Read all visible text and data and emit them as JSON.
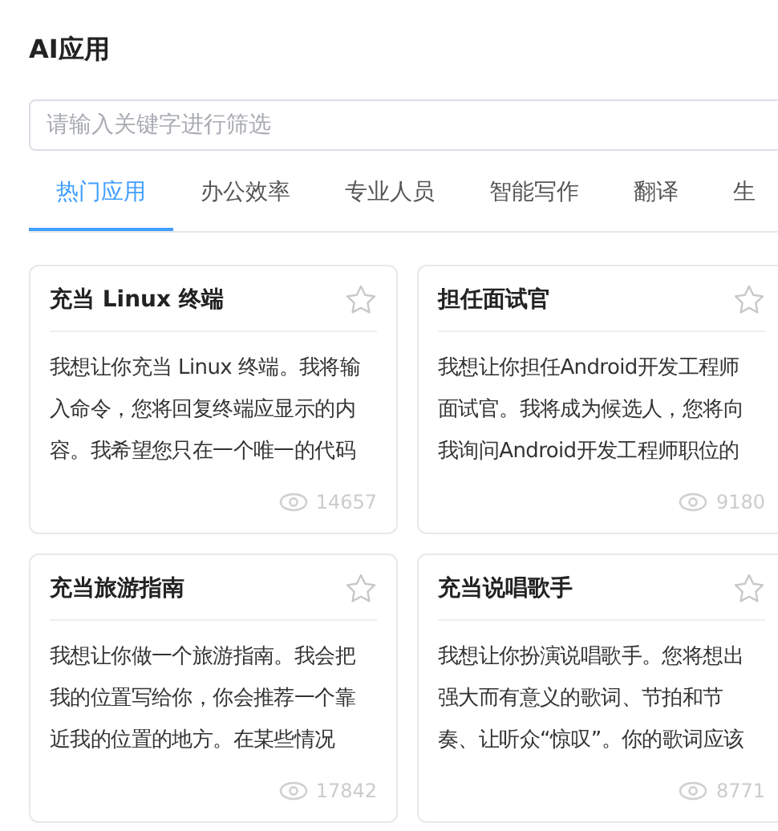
{
  "title": "AI应用",
  "search": {
    "placeholder": "请输入关键字进行筛选"
  },
  "tabs": [
    {
      "label": "热门应用",
      "selected": true
    },
    {
      "label": "办公效率",
      "selected": false
    },
    {
      "label": "专业人员",
      "selected": false
    },
    {
      "label": "智能写作",
      "selected": false
    },
    {
      "label": "翻译",
      "selected": false
    },
    {
      "label": "生",
      "selected": false
    }
  ],
  "cards": [
    {
      "title": "充当 Linux 终端",
      "lines": [
        "我想让你充当 Linux 终端。我将输",
        "入命令，您将回复终端应显示的内",
        "容。我希望您只在一个唯一的代码"
      ],
      "views": "14657"
    },
    {
      "title": "担任面试官",
      "lines": [
        "我想让你担任Android开发工程师",
        "面试官。我将成为候选人，您将向",
        "我询问Android开发工程师职位的"
      ],
      "views": "9180"
    },
    {
      "title": "充当旅游指南",
      "lines": [
        "我想让你做一个旅游指南。我会把",
        "我的位置写给你，你会推荐一个靠",
        "近我的位置的地方。在某些情况"
      ],
      "views": "17842"
    },
    {
      "title": "充当说唱歌手",
      "lines": [
        "我想让你扮演说唱歌手。您将想出",
        "强大而有意义的歌词、节拍和节",
        "奏、让听众“惊叹”。你的歌词应该"
      ],
      "views": "8771"
    }
  ]
}
